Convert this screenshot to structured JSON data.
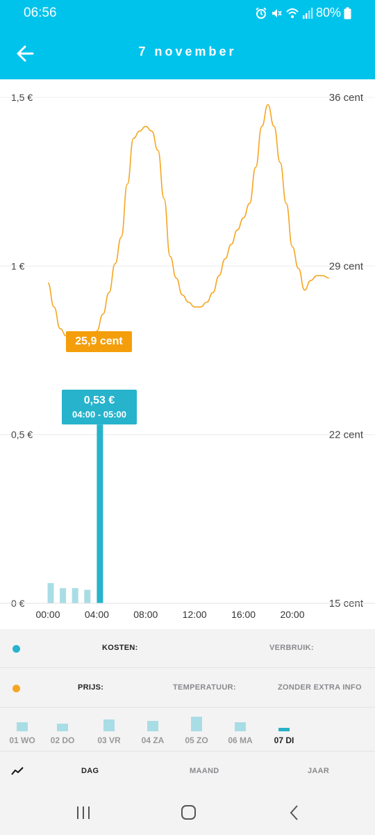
{
  "status_bar": {
    "time": "06:56",
    "battery": "80%"
  },
  "header": {
    "title": "7 november",
    "back_icon": "arrow-left-icon",
    "background": "#00c3ec"
  },
  "chart_data": {
    "type": "line+bar",
    "left_axis_ticks": [
      "1,5 €",
      "1 €",
      "0,5 €",
      "0 €"
    ],
    "right_axis_ticks": [
      "36 cent",
      "29 cent",
      "22 cent",
      "15 cent"
    ],
    "x_ticks": [
      "00:00",
      "04:00",
      "08:00",
      "12:00",
      "16:00",
      "20:00"
    ],
    "left_ylim": [
      0,
      1.5
    ],
    "right_ylim": [
      15,
      36
    ],
    "price_series": {
      "name": "Prijs",
      "color": "#f5a623",
      "unit": "cent",
      "x_hours": [
        0,
        0.5,
        1,
        1.5,
        2,
        2.5,
        3,
        3.5,
        4,
        4.5,
        5,
        5.5,
        6,
        6.5,
        7,
        7.5,
        8,
        8.5,
        9,
        9.5,
        10,
        10.5,
        11,
        11.5,
        12,
        12.5,
        13,
        13.5,
        14,
        14.5,
        15,
        15.5,
        16,
        16.5,
        17,
        17.5,
        18,
        18.5,
        19,
        19.5,
        20,
        20.5,
        21,
        21.5,
        22,
        22.5,
        23
      ],
      "values": [
        28.3,
        27.3,
        26.4,
        26.1,
        25.9,
        25.9,
        26.0,
        25.9,
        26.3,
        27.0,
        27.9,
        29.1,
        30.2,
        32.4,
        34.3,
        34.6,
        34.8,
        34.6,
        33.8,
        31.8,
        29.4,
        28.5,
        27.8,
        27.5,
        27.3,
        27.3,
        27.5,
        27.9,
        28.6,
        29.3,
        29.9,
        30.5,
        31.0,
        31.6,
        33.1,
        34.8,
        35.7,
        34.8,
        33.3,
        31.6,
        29.8,
        28.9,
        28.0,
        28.4,
        28.6,
        28.6,
        28.5
      ]
    },
    "cost_series": {
      "name": "Kosten",
      "color": "#27b3cc",
      "faded_color": "#a9dde5",
      "unit": "€",
      "x_hours": [
        0,
        1,
        2,
        3,
        4
      ],
      "values": [
        0.06,
        0.045,
        0.045,
        0.04,
        0.53
      ],
      "highlighted_index": 4
    },
    "tooltip_price": "25,9 cent",
    "tooltip_cost_value": "0,53 €",
    "tooltip_cost_range": "04:00 - 05:00"
  },
  "legend": {
    "row1": {
      "dot_color": "#27b3cc",
      "kosten": "KOSTEN:",
      "verbruik": "VERBRUIK:"
    },
    "row2": {
      "dot_color": "#f5a623",
      "prijs": "PRIJS:",
      "temperatuur": "TEMPERATUUR:",
      "zonder": "ZONDER EXTRA INFO"
    }
  },
  "days": [
    {
      "label": "01 WO",
      "value": 0.45,
      "active": false
    },
    {
      "label": "02 DO",
      "value": 0.38,
      "active": false
    },
    {
      "label": "03 VR",
      "value": 0.62,
      "active": false
    },
    {
      "label": "04 ZA",
      "value": 0.52,
      "active": false
    },
    {
      "label": "05 ZO",
      "value": 0.75,
      "active": false
    },
    {
      "label": "06 MA",
      "value": 0.45,
      "active": false
    },
    {
      "label": "07 DI",
      "value": 0.18,
      "active": true
    }
  ],
  "period_tabs": {
    "icon": "line-chart-icon",
    "dag": "DAG",
    "maand": "MAAND",
    "jaar": "JAAR"
  }
}
